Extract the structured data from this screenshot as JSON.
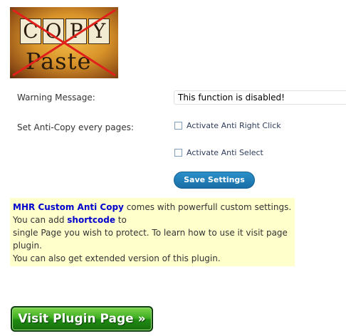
{
  "logo": {
    "copy_letters": [
      "C",
      "O",
      "P",
      "Y"
    ],
    "paste_word": "Paste"
  },
  "form": {
    "warning_label": "Warning Message:",
    "warning_value": "This function is disabled!",
    "anticopy_label": "Set Anti-Copy every pages:",
    "right_click_label": "Activate Anti Right Click",
    "right_click_checked": false,
    "select_label": "Activate Anti Select",
    "select_checked": false,
    "save_label": "Save Settings"
  },
  "info": {
    "plugin_name": "MHR Custom Anti Copy",
    "text_1": " comes with powerfull custom settings. You can add ",
    "shortcode": "shortcode",
    "text_2": " to",
    "line_3": "single Page you wish to protect. To learn how to use it visit page plugin.",
    "line_4": "You can also get extended version of this plugin."
  },
  "visit_button": {
    "label": "Visit Plugin Page »"
  },
  "colors": {
    "info_bg": "#ffffcc",
    "link_blue": "#0000cc",
    "save_button": "#2180b9",
    "visit_green": "#2f9e1b"
  }
}
